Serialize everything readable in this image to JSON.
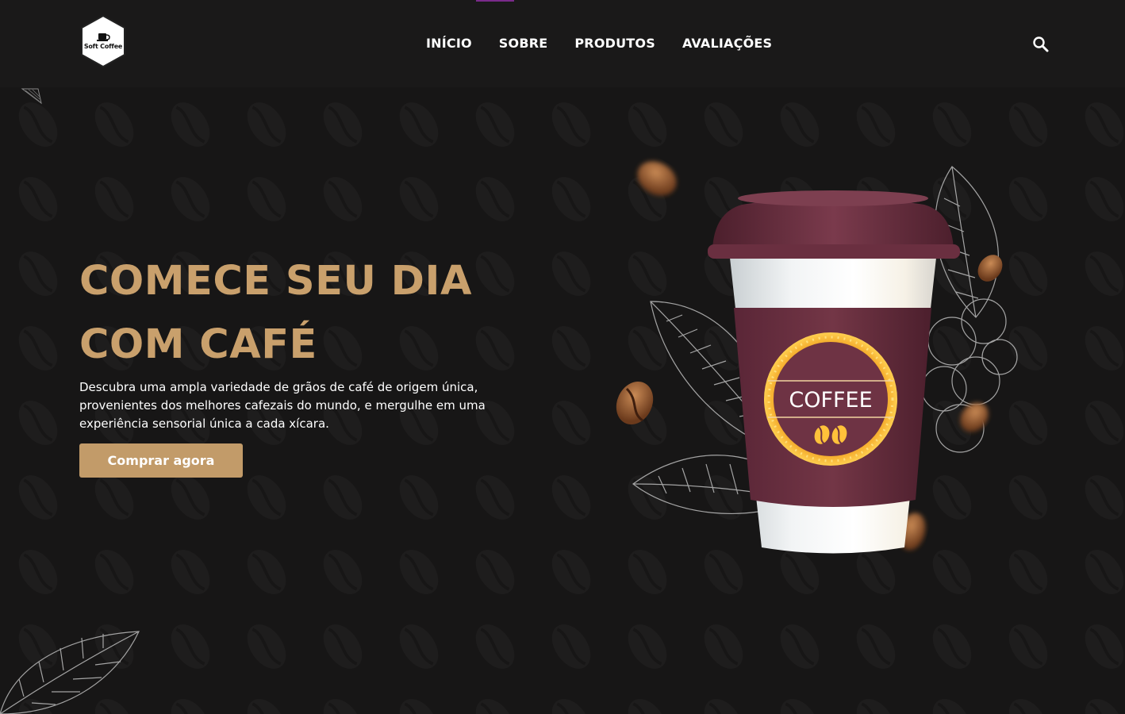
{
  "brand": {
    "logo_text": "Soft Coffee"
  },
  "nav": {
    "items": [
      {
        "label": "INÍCIO"
      },
      {
        "label": "SOBRE"
      },
      {
        "label": "PRODUTOS"
      },
      {
        "label": "AVALIAÇÕES"
      }
    ],
    "search_icon": "search-icon"
  },
  "hero": {
    "title_line1": "COMECE SEU DIA",
    "title_line2": "COM CAFÉ",
    "description": "Descubra uma ampla variedade de grãos de café de origem única, provenientes dos melhores cafezais do mundo, e mergulhe em uma experiência sensorial única a cada xícara.",
    "cta_label": "Comprar agora",
    "cup_label": "COFFEE"
  },
  "colors": {
    "background": "#171616",
    "header": "#1a1919",
    "accent_gold": "#c9a06c",
    "button": "#c29b69",
    "cup_sleeve": "#6e3344"
  }
}
